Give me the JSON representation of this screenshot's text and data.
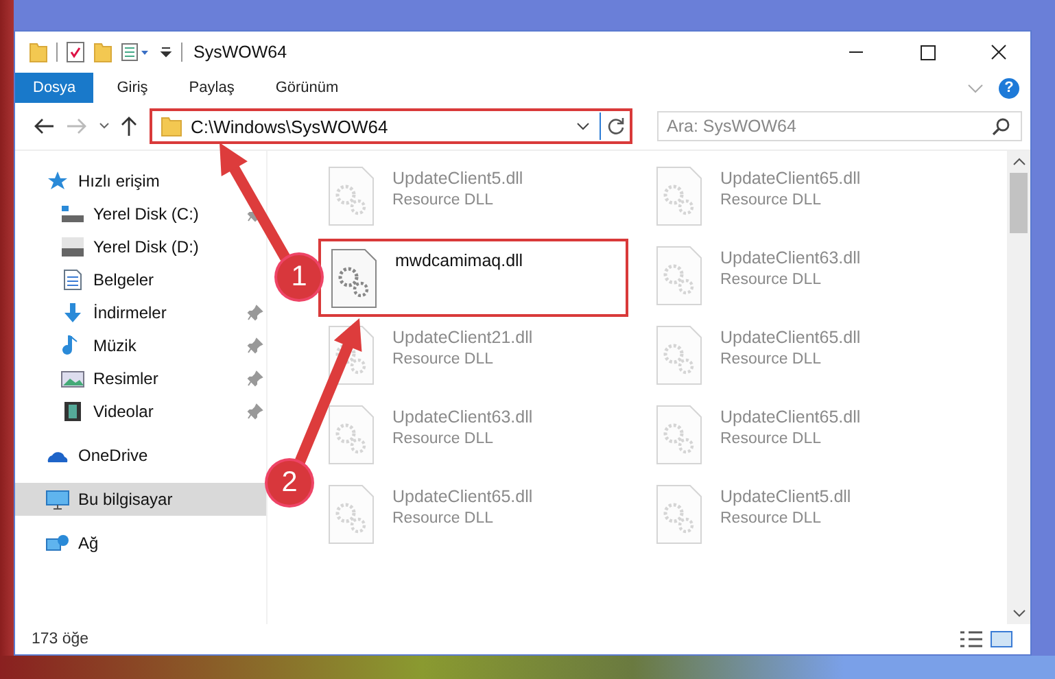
{
  "window": {
    "title": "SysWOW64"
  },
  "ribbon": {
    "tabs": [
      {
        "label": "Dosya",
        "kind": "file"
      },
      {
        "label": "Giriş",
        "kind": "tab"
      },
      {
        "label": "Paylaş",
        "kind": "tab"
      },
      {
        "label": "Görünüm",
        "kind": "tab"
      }
    ],
    "help": "?"
  },
  "address": {
    "path": "C:\\Windows\\SysWOW64",
    "highlighted": true
  },
  "search": {
    "placeholder": "Ara: SysWOW64"
  },
  "sidebar": {
    "items": [
      {
        "label": "Hızlı erişim",
        "kind": "star",
        "selected": false,
        "children": [
          {
            "label": "Yerel Disk (C:)",
            "kind": "drive-c",
            "pinned": true
          },
          {
            "label": "Yerel Disk (D:)",
            "kind": "drive",
            "pinned": false
          },
          {
            "label": "Belgeler",
            "kind": "doc",
            "pinned": false
          },
          {
            "label": "İndirmeler",
            "kind": "download",
            "pinned": true
          },
          {
            "label": "Müzik",
            "kind": "music",
            "pinned": true
          },
          {
            "label": "Resimler",
            "kind": "picture",
            "pinned": true
          },
          {
            "label": "Videolar",
            "kind": "video",
            "pinned": true
          }
        ]
      },
      {
        "label": "OneDrive",
        "kind": "cloud",
        "selected": false
      },
      {
        "label": "Bu bilgisayar",
        "kind": "computer",
        "selected": true
      },
      {
        "label": "Ağ",
        "kind": "network",
        "selected": false
      }
    ]
  },
  "files": [
    {
      "name": "UpdateClient5.dll",
      "subtitle": "Resource DLL",
      "blurred": true,
      "highlighted": false
    },
    {
      "name": "UpdateClient65.dll",
      "subtitle": "Resource DLL",
      "blurred": true,
      "highlighted": false
    },
    {
      "name": "mwdcamimaq.dll",
      "blurred": false,
      "highlighted": true
    },
    {
      "name": "UpdateClient63.dll",
      "subtitle": "Resource DLL",
      "blurred": true,
      "highlighted": false
    },
    {
      "name": "UpdateClient21.dll",
      "subtitle": "Resource DLL",
      "blurred": true,
      "highlighted": false
    },
    {
      "name": "UpdateClient65.dll",
      "subtitle": "Resource DLL",
      "blurred": true,
      "highlighted": false
    },
    {
      "name": "UpdateClient63.dll",
      "subtitle": "Resource DLL",
      "blurred": true,
      "highlighted": false
    },
    {
      "name": "UpdateClient65.dll",
      "subtitle": "Resource DLL",
      "blurred": true,
      "highlighted": false
    },
    {
      "name": "UpdateClient65.dll",
      "subtitle": "Resource DLL",
      "blurred": true,
      "highlighted": false
    },
    {
      "name": "UpdateClient5.dll",
      "subtitle": "Resource DLL",
      "blurred": true,
      "highlighted": false
    }
  ],
  "status_bar": {
    "count": "173 öğe"
  },
  "annotations": [
    {
      "number": "1"
    },
    {
      "number": "2"
    }
  ]
}
